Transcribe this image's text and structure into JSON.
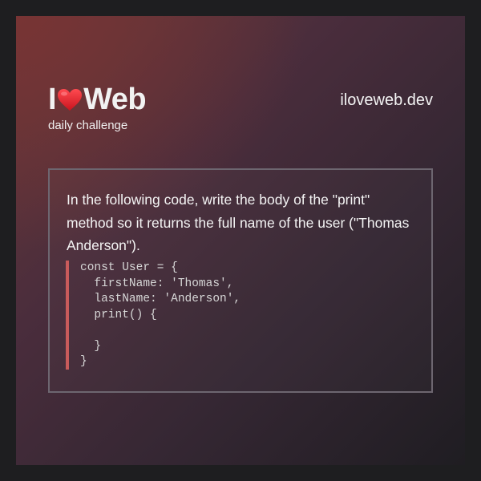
{
  "brand": {
    "logo_left": "I",
    "logo_right": "Web",
    "heart_icon": "heart-icon",
    "heart_color": "#e3212c",
    "subtitle": "daily challenge",
    "site": "iloveweb.dev"
  },
  "challenge": {
    "question": "In the following code, write the body of the \"print\" method so it returns the full name of the user (\"Thomas Anderson\").",
    "code_lines": [
      "const User = {",
      "  firstName: 'Thomas',",
      "  lastName: 'Anderson',",
      "  print() {",
      "",
      "  }",
      "}"
    ]
  },
  "colors": {
    "code_border": "#c95b5b",
    "box_border": "#6d6670",
    "text": "#f4f4f4"
  }
}
